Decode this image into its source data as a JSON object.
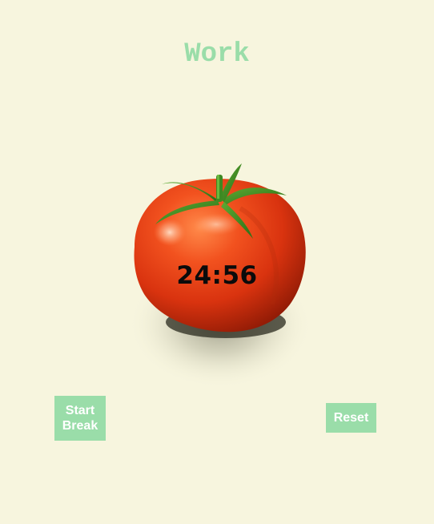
{
  "mode_title": "Work",
  "timer": {
    "display": "24:56"
  },
  "buttons": {
    "start_break_label": "Start Break",
    "reset_label": "Reset"
  },
  "colors": {
    "background": "#F7F5DE",
    "accent": "#9ADDA9",
    "tomato": "#E53A12",
    "leaf": "#3D8A22"
  },
  "icons": {
    "tomato": "tomato-icon"
  }
}
